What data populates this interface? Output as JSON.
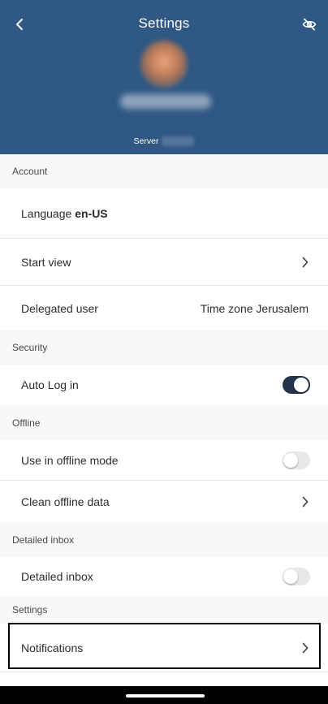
{
  "header": {
    "title": "Settings",
    "server_label": "Server",
    "icons": {
      "back": "chevron-left-icon",
      "visibility": "eye-off-icon"
    },
    "colors": {
      "background": "#2f5884"
    }
  },
  "account": {
    "section_label": "Account",
    "language_label": "Language",
    "language_value": "en-US",
    "start_view_label": "Start view",
    "delegated_user_label": "Delegated user",
    "time_zone_text": "Time zone Jerusalem"
  },
  "security": {
    "section_label": "Security",
    "auto_login_label": "Auto Log in",
    "auto_login_on": true
  },
  "offline": {
    "section_label": "Offline",
    "offline_mode_label": "Use in offline mode",
    "offline_mode_on": false,
    "clean_data_label": "Clean offline data"
  },
  "detailed_inbox": {
    "section_label": "Detailed inbox",
    "toggle_label": "Detailed inbox",
    "toggle_on": false
  },
  "settings": {
    "section_label": "Settings",
    "notifications_label": "Notifications"
  }
}
